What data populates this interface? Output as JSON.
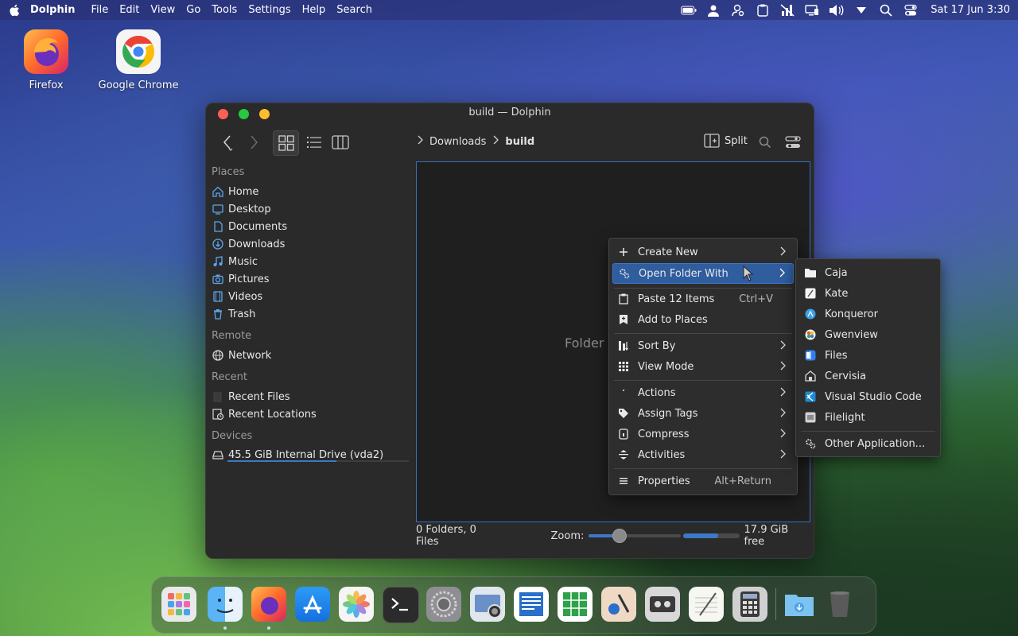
{
  "menubar": {
    "app_name": "Dolphin",
    "menus": [
      "File",
      "Edit",
      "View",
      "Go",
      "Tools",
      "Settings",
      "Help",
      "Search"
    ],
    "clock": "Sat 17 Jun 3:30"
  },
  "desktop": {
    "icons": [
      {
        "label": "Firefox",
        "icon": "firefox-icon"
      },
      {
        "label": "Google Chrome",
        "icon": "chrome-icon"
      }
    ]
  },
  "window": {
    "title": "build — Dolphin",
    "breadcrumb": [
      "Downloads",
      "build"
    ],
    "split_label": "Split",
    "empty_text": "Folder",
    "status": {
      "counts": "0 Folders, 0 Files",
      "zoom_label": "Zoom:",
      "zoom_level": 0.3,
      "disk_used_fraction": 0.63,
      "free_space": "17.9 GiB free"
    }
  },
  "sidebar": {
    "places_header": "Places",
    "places": [
      "Home",
      "Desktop",
      "Documents",
      "Downloads",
      "Music",
      "Pictures",
      "Videos",
      "Trash"
    ],
    "remote_header": "Remote",
    "remote": [
      "Network"
    ],
    "recent_header": "Recent",
    "recent": [
      "Recent Files",
      "Recent Locations"
    ],
    "devices_header": "Devices",
    "devices": [
      "45.5 GiB Internal Drive (vda2)"
    ]
  },
  "context_menu": {
    "items": {
      "create_new": "Create New",
      "open_folder_with": "Open Folder With",
      "paste": "Paste 12 Items",
      "paste_shortcut": "Ctrl+V",
      "add_to_places": "Add to Places",
      "sort_by": "Sort By",
      "view_mode": "View Mode",
      "actions": "Actions",
      "assign_tags": "Assign Tags",
      "compress": "Compress",
      "activities": "Activities",
      "properties": "Properties",
      "properties_shortcut": "Alt+Return"
    }
  },
  "submenu": {
    "apps": [
      "Caja",
      "Kate",
      "Konqueror",
      "Gwenview",
      "Files",
      "Cervisia",
      "Visual Studio Code",
      "Filelight"
    ],
    "other": "Other Application..."
  },
  "colors": {
    "accent": "#3d78c6",
    "highlight": "#2f5d9e",
    "close": "#ff5f57",
    "minimize": "#28c840",
    "maximize": "#febc2e"
  }
}
